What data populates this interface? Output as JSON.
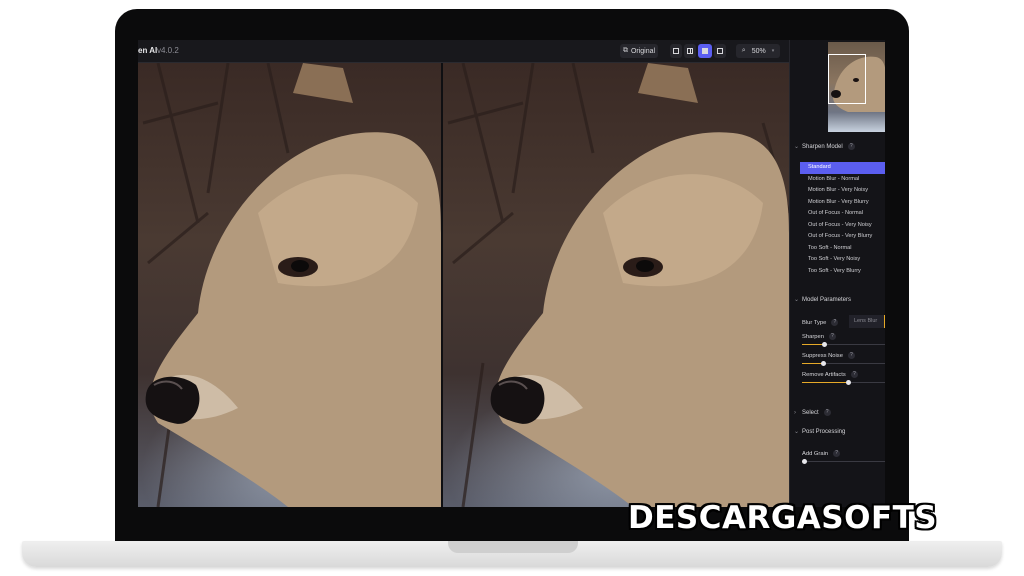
{
  "app": {
    "title": "en AI",
    "version": "v4.0.2"
  },
  "toolbar": {
    "original_label": "Original",
    "zoom_label": "50%"
  },
  "sidebar": {
    "sharpen_model": {
      "title": "Sharpen Model",
      "models": [
        "Standard",
        "Motion Blur - Normal",
        "Motion Blur - Very Noisy",
        "Motion Blur - Very Blurry",
        "Out of Focus - Normal",
        "Out of Focus - Very Noisy",
        "Out of Focus - Very Blurry",
        "Too Soft - Normal",
        "Too Soft - Very Noisy",
        "Too Soft - Very Blurry"
      ],
      "selected_index": 0
    },
    "model_parameters": {
      "title": "Model Parameters",
      "blur_type_label": "Blur Type",
      "blur_type_value": "Lens Blur",
      "sharpen_label": "Sharpen",
      "sharpen_level": 0.27,
      "suppress_noise_label": "Suppress Noise",
      "suppress_noise_level": 0.25,
      "remove_artifacts_label": "Remove Artifacts",
      "remove_artifacts_level": 0.55
    },
    "select": {
      "title": "Select"
    },
    "post_processing": {
      "title": "Post Processing",
      "add_grain_label": "Add Grain",
      "add_grain_level": 0.02
    }
  },
  "watermark": {
    "text": "DESCARGASOFTS"
  },
  "colors": {
    "accent": "#5b5ef0",
    "slider": "#e6a928",
    "panel": "#141418"
  }
}
